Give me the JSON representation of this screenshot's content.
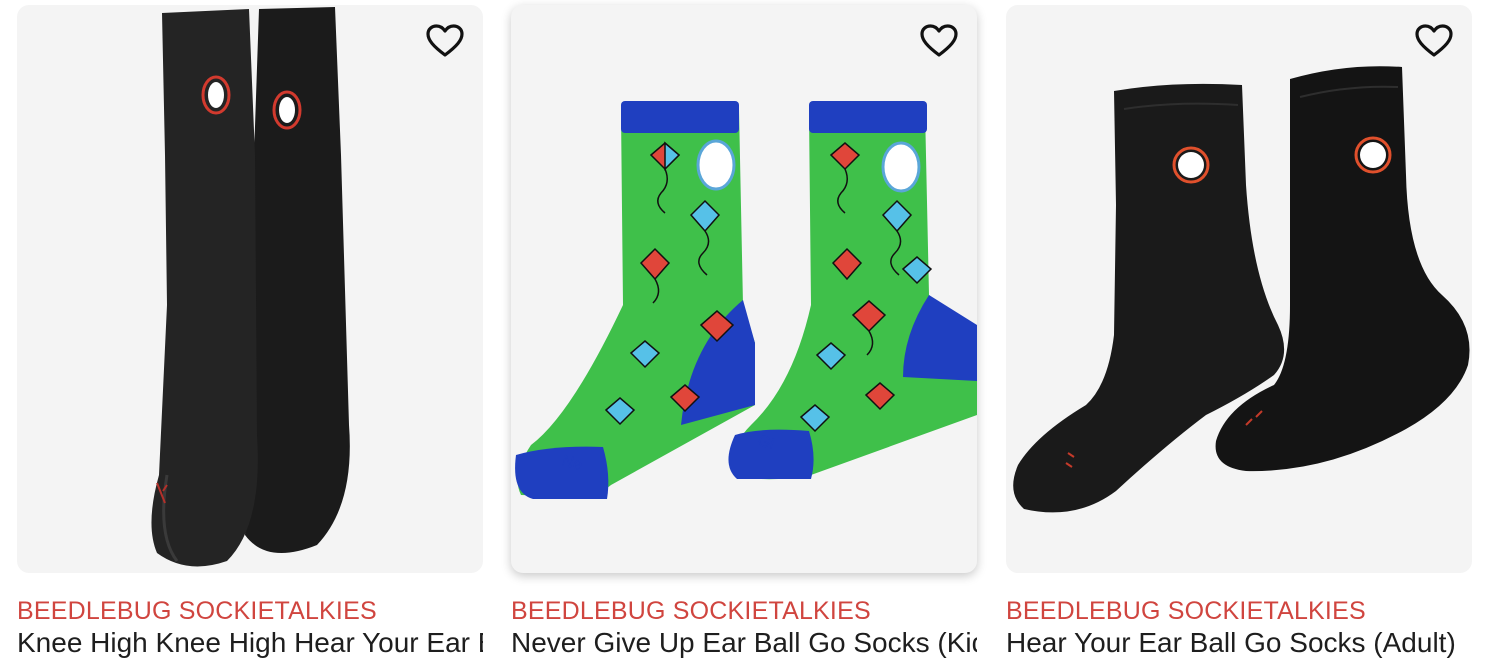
{
  "products": [
    {
      "brand": "BEEDLEBUG SOCKIETALKIES",
      "title": "Knee High Knee High Hear Your Ear Ball Sox Socks (Kids)",
      "wishlist_icon": "heart-outline-icon",
      "image": "black-knee-high-socks"
    },
    {
      "brand": "BEEDLEBUG SOCKIETALKIES",
      "title": "Never Give Up Ear Ball Go Socks (Kids)",
      "wishlist_icon": "heart-outline-icon",
      "image": "green-kite-socks"
    },
    {
      "brand": "BEEDLEBUG SOCKIETALKIES",
      "title": "Hear Your Ear Ball Go Socks (Adult)",
      "wishlist_icon": "heart-outline-icon",
      "image": "black-crew-socks"
    }
  ],
  "colors": {
    "brand_text": "#d0453f",
    "card_bg": "#f4f4f4",
    "kite_green": "#3fc04a",
    "trim_blue": "#1f3fc0"
  }
}
